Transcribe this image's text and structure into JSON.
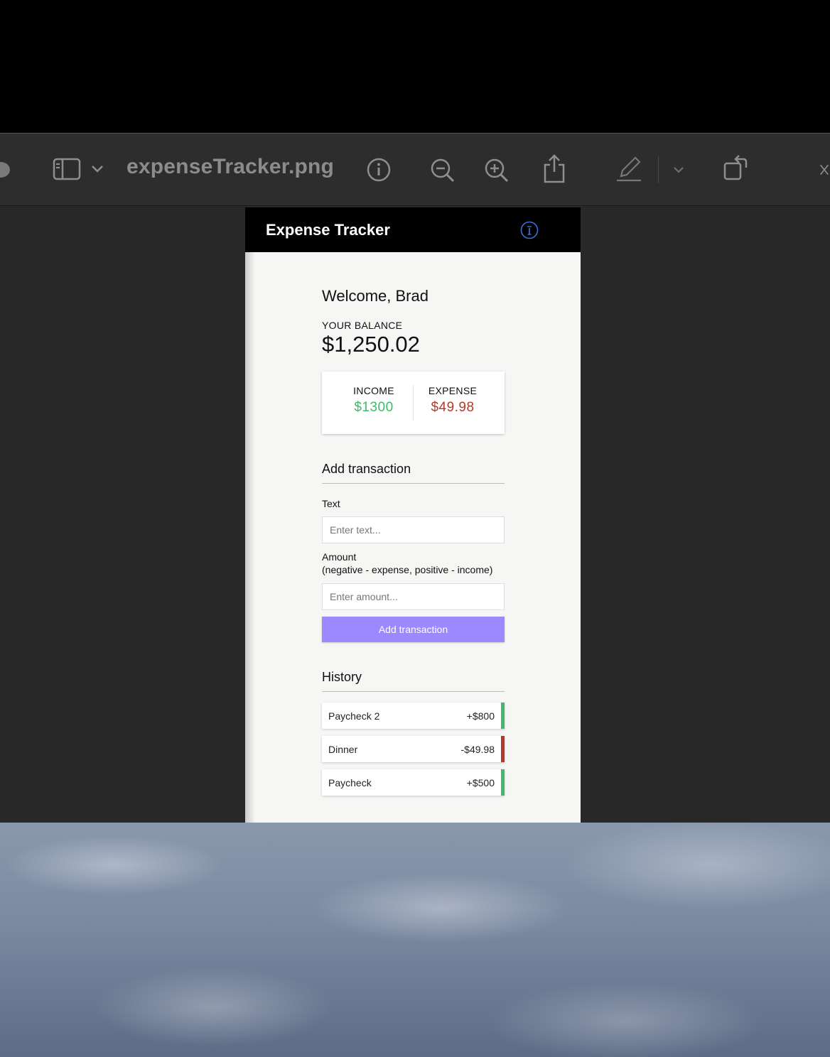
{
  "window": {
    "document_title": "expenseTracker.png"
  },
  "toolbar": {
    "icons": [
      "sidebar-icon",
      "chevron-down-icon",
      "info-icon",
      "zoom-out-icon",
      "zoom-in-icon",
      "share-icon",
      "markup-pen-icon",
      "chevron-down-icon",
      "rotate-icon",
      "close-icon"
    ]
  },
  "app": {
    "title": "Expense Tracker",
    "welcome": "Welcome, Brad",
    "balance_label": "YOUR BALANCE",
    "balance_value": "$1,250.02",
    "income_label": "INCOME",
    "income_value": "$1300",
    "expense_label": "EXPENSE",
    "expense_value": "$49.98",
    "income_color": "#3fba6a",
    "expense_color": "#b33a2b",
    "add_section_title": "Add transaction",
    "text_label": "Text",
    "text_placeholder": "Enter text...",
    "amount_label": "Amount",
    "amount_hint": "(negative - expense, positive - income)",
    "amount_placeholder": "Enter amount...",
    "add_button_label": "Add transaction",
    "button_color": "#9c88ff",
    "history_title": "History",
    "history": [
      {
        "text": "Paycheck 2",
        "amount": "+$800",
        "type": "income"
      },
      {
        "text": "Dinner",
        "amount": "-$49.98",
        "type": "expense"
      },
      {
        "text": "Paycheck",
        "amount": "+$500",
        "type": "income"
      }
    ]
  }
}
